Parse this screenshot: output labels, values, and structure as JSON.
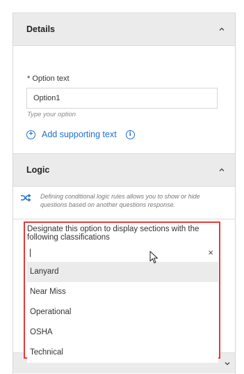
{
  "details": {
    "title": "Details"
  },
  "option": {
    "label": "* Option text",
    "value": "Option1",
    "hint": "Type your option",
    "add_supporting_label": "Add supporting text"
  },
  "logic": {
    "title": "Logic",
    "description": "Defining conditional logic rules allows you to show or hide questions based on another questions response."
  },
  "classification": {
    "prompt": "Designate this option to display sections with the following classifications",
    "search_value": "",
    "clear_glyph": "×",
    "options": [
      "Lanyard",
      "Near Miss",
      "Operational",
      "OSHA",
      "Technical"
    ]
  },
  "colors": {
    "accent": "#1f6fd1",
    "highlight_border": "#e53935"
  }
}
